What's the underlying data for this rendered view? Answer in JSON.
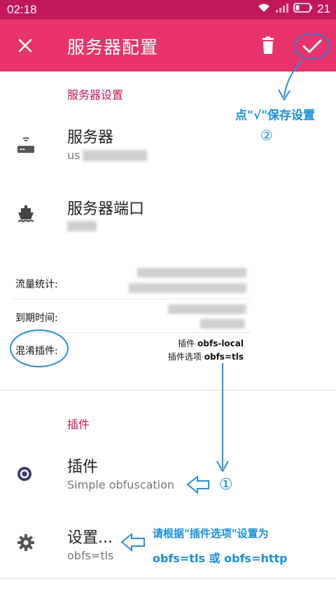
{
  "status_bar": {
    "time": "02:18",
    "battery": "21",
    "icons": [
      "wifi-icon",
      "signal-icon",
      "battery-icon"
    ]
  },
  "app_bar": {
    "title": "服务器配置",
    "close_icon": "close-icon",
    "delete_icon": "delete-icon",
    "save_icon": "check-icon",
    "color": "#e8336c"
  },
  "server_section": {
    "header": "服务器设置",
    "items": [
      {
        "title": "服务器",
        "value": "us",
        "icon": "router-icon"
      },
      {
        "title": "服务器端口",
        "value": "",
        "icon": "ship-icon"
      }
    ]
  },
  "info_panel": {
    "traffic_label": "流量统计:",
    "expire_label": "到期时间:",
    "obfs_label": "混淆插件:",
    "plugin_prefix": "插件",
    "plugin_value": "obfs-local",
    "plugin_opts_prefix": "插件选项",
    "plugin_opts_value": "obfs=tls"
  },
  "plugin_section": {
    "header": "插件",
    "items": [
      {
        "title": "插件",
        "value": "Simple obfuscation",
        "icon": "plugin-icon"
      },
      {
        "title": "设置...",
        "value": "obfs=tls",
        "icon": "gear-icon"
      }
    ]
  },
  "annotations": {
    "save_hint": "点\"√\"保存设置",
    "step2": "②",
    "step1": "①",
    "hint_line1": "请根据\"插件选项\"设置为",
    "hint_line2": "obfs=tls 或 obfs=http",
    "color": "#1a8fd8"
  }
}
